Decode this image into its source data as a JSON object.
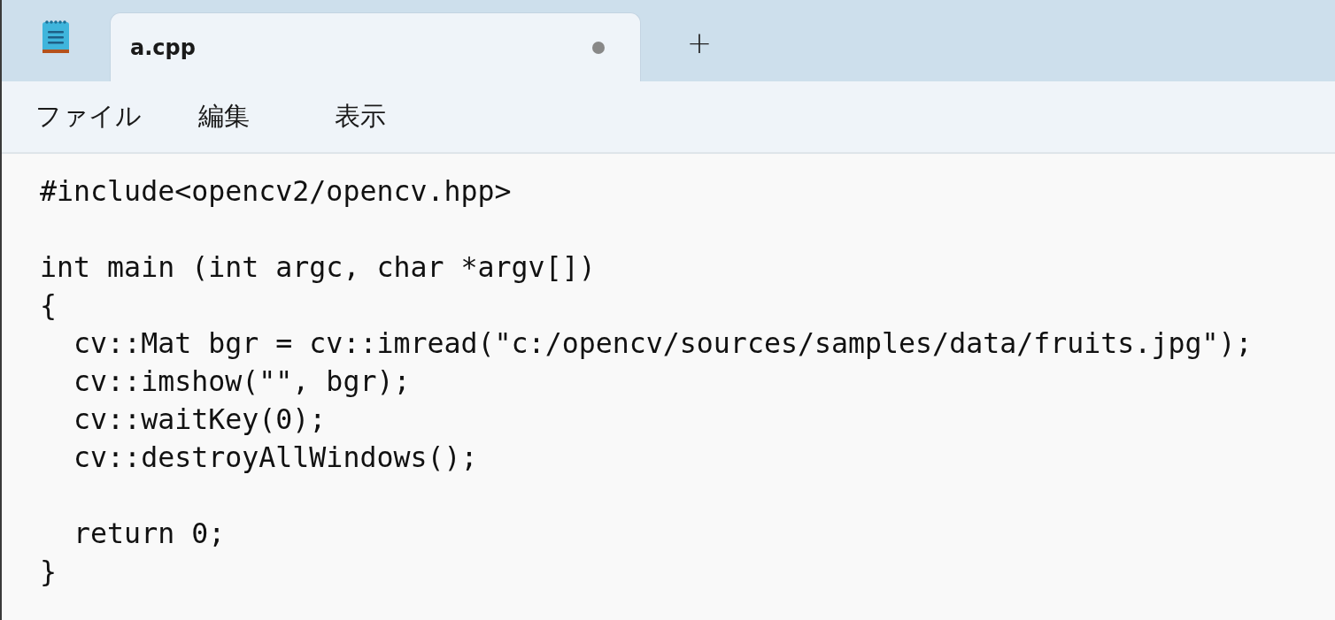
{
  "tabs": [
    {
      "label": "a.cpp",
      "selected": true,
      "modified": true
    }
  ],
  "new_tab": "+",
  "menu": [
    "ファイル",
    "編集",
    "表示"
  ],
  "code": {
    "lines": [
      {
        "kind": "text",
        "text": "#include<opencv2/opencv.hpp>"
      },
      {
        "kind": "blank"
      },
      {
        "kind": "text",
        "text": "int main (int argc, char *argv[])"
      },
      {
        "kind": "text",
        "text": "{"
      },
      {
        "kind": "text",
        "text": "  cv::Mat bgr = cv::imread(\"c:/opencv/sources/samples/data/fruits.jpg\");"
      },
      {
        "kind": "text",
        "text": "  cv::imshow(\"\", bgr);"
      },
      {
        "kind": "text",
        "text": "  cv::waitKey(0);"
      },
      {
        "kind": "text",
        "text": "  cv::destroyAllWindows();"
      },
      {
        "kind": "blank"
      },
      {
        "kind": "text",
        "text": "  return 0;"
      },
      {
        "kind": "text",
        "text": "}"
      }
    ]
  }
}
